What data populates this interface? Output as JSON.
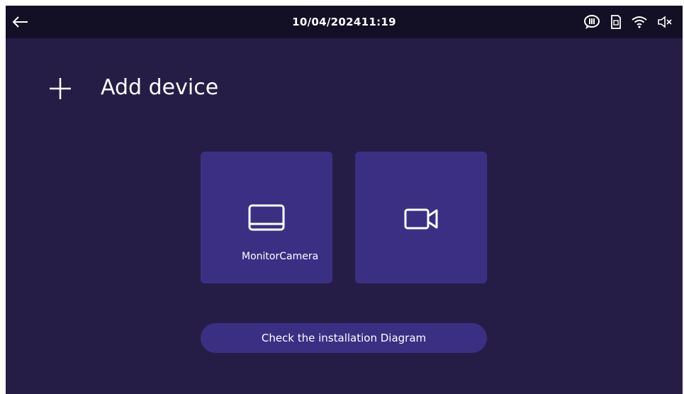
{
  "status_bar": {
    "datetime": "10/04/202411:19",
    "icons": [
      "back-arrow-icon",
      "speech-bubble-icon",
      "sd-card-icon",
      "wifi-icon",
      "speaker-muted-icon"
    ]
  },
  "page": {
    "title": "Add device",
    "title_icon": "plus-icon"
  },
  "tiles": [
    {
      "icon": "monitor-icon",
      "label": "MonitorCamera"
    },
    {
      "icon": "video-camera-icon",
      "label": ""
    }
  ],
  "install_button": {
    "label": "Check the installation Diagram"
  },
  "colors": {
    "background": "#261d47",
    "status_bar": "#130f24",
    "tile": "#3b2f84",
    "text": "#ffffff"
  }
}
